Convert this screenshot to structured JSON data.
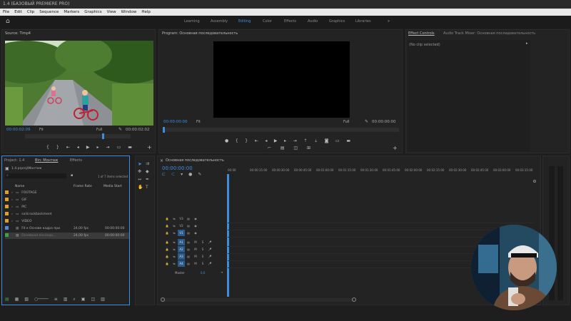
{
  "titlebar": {
    "text": "1.4 (БАЗОВЫЙ PREMIERE PRO)"
  },
  "menu": [
    "File",
    "Edit",
    "Clip",
    "Sequence",
    "Markers",
    "Graphics",
    "View",
    "Window",
    "Help"
  ],
  "workspaces": [
    "Learning",
    "Assembly",
    "Editing",
    "Color",
    "Effects",
    "Audio",
    "Graphics",
    "Libraries"
  ],
  "workspace_active": "Editing",
  "colors": {
    "accent": "#3e8ee0",
    "panel": "#232323",
    "bg": "#1e1e1e"
  },
  "source": {
    "title": "Source: Timp4",
    "timecode_left": "00:00:02:09",
    "fit": "Fit",
    "quality": "Full",
    "timecode_right": "00:00:02:02"
  },
  "program": {
    "title": "Program: Основная последовательность",
    "timecode_left": "00:00:00:00",
    "fit": "Fit",
    "quality": "Full",
    "timecode_right": "00:00:00:00"
  },
  "effect_controls": {
    "tab1": "Effect Controls",
    "tab2": "Audio Track Mixer: Основная последовательность",
    "placeholder": "(No clip selected)"
  },
  "project": {
    "tab1": "Project: 1.4",
    "tab2": "Bin: Монтаж",
    "tab3": "Effects",
    "path": "1.4.prproj\\Монтаж",
    "count": "1 of 7 items selected",
    "col_name": "Name",
    "col_framerate": "Frame Rate",
    "col_mediastart": "Media Start",
    "items": [
      {
        "name": "FOOTAGE",
        "color": "#e0a030",
        "fr": "",
        "ms": ""
      },
      {
        "name": "GIF",
        "color": "#e0a030",
        "fr": "",
        "ms": ""
      },
      {
        "name": "PIC",
        "color": "#e0a030",
        "fr": "",
        "ms": ""
      },
      {
        "name": "soilcrackbackment",
        "color": "#e0a030",
        "fr": "",
        "ms": ""
      },
      {
        "name": "VIDEO",
        "color": "#e0a030",
        "fr": "",
        "ms": ""
      },
      {
        "name": "Fit к Основе кадра при",
        "color": "#5b86e0",
        "fr": "24,00 fps",
        "ms": "00:00:00:00"
      },
      {
        "name": "Основная последо...",
        "color": "#3fa04a",
        "fr": "24,00 fps",
        "ms": "00:00:00:00"
      }
    ]
  },
  "timeline": {
    "tab": "Основная последовательность",
    "timecode": "00:00:00:00",
    "ruler": [
      "00:00",
      "00:00:15:00",
      "00:00:30:00",
      "00:00:45:00",
      "00:01:00:00",
      "00:01:15:00",
      "00:01:30:00",
      "00:01:45:00",
      "00:02:00:00",
      "00:02:15:00",
      "00:02:30:00",
      "00:02:45:00",
      "00:03:00:00",
      "00:03:15:00"
    ],
    "video_tracks": [
      "V3",
      "V2",
      "V1"
    ],
    "audio_tracks": [
      "A1",
      "A2",
      "A3",
      "A4"
    ],
    "master": "Master",
    "master_value": "0,0"
  }
}
